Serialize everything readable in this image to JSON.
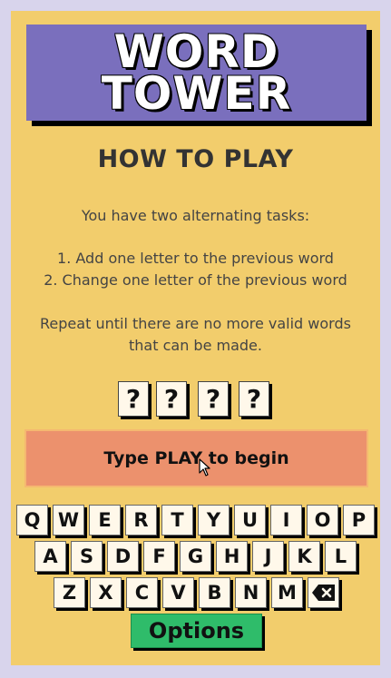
{
  "logo": {
    "line1": "WORD",
    "line2": "TOWER"
  },
  "heading": "HOW TO PLAY",
  "instructions": {
    "intro": "You have two alternating tasks:",
    "task1": "1. Add one letter to the previous word",
    "task2": "2. Change one letter of the previous word",
    "outro_line1": "Repeat until there are no more valid words",
    "outro_line2": "that can be made."
  },
  "word_slots": [
    "?",
    "?",
    "?",
    "?"
  ],
  "prompt": "Type PLAY to begin",
  "keyboard": {
    "row1": [
      "Q",
      "W",
      "E",
      "R",
      "T",
      "Y",
      "U",
      "I",
      "O",
      "P"
    ],
    "row2": [
      "A",
      "S",
      "D",
      "F",
      "G",
      "H",
      "J",
      "K",
      "L"
    ],
    "row3": [
      "Z",
      "X",
      "C",
      "V",
      "B",
      "N",
      "M"
    ],
    "backspace_icon": "backspace-icon"
  },
  "options_label": "Options",
  "colors": {
    "background": "#f2cd6c",
    "logo": "#7a6fbd",
    "prompt": "#ec916d",
    "options": "#2fbc6a"
  }
}
